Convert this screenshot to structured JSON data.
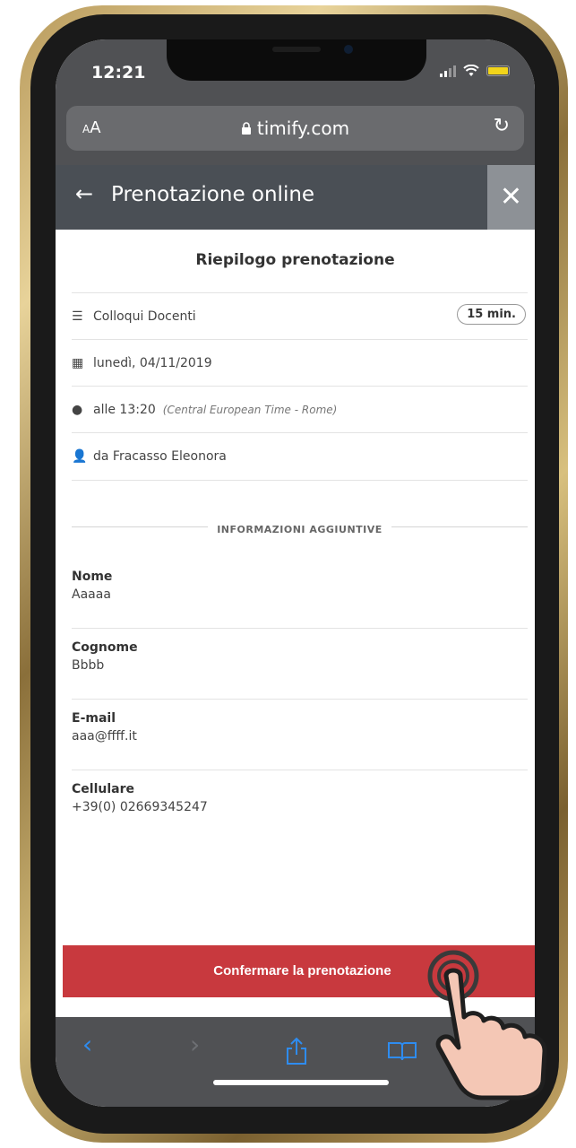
{
  "status_bar": {
    "time": "12:21"
  },
  "safari": {
    "text_size_label": "AA",
    "domain": "timify.com",
    "reload_icon": "reload-icon"
  },
  "header": {
    "back_icon": "arrow-left-icon",
    "title": "Prenotazione online",
    "close_icon": "close-icon"
  },
  "summary": {
    "title": "Riepilogo prenotazione",
    "service": "Colloqui Docenti",
    "duration": "15 min.",
    "date": "lunedì, 04/11/2019",
    "time": "alle 13:20",
    "timezone": "(Central European Time - Rome)",
    "staff": "da Fracasso Eleonora"
  },
  "additional_info": {
    "heading": "INFORMAZIONI AGGIUNTIVE",
    "fields": [
      {
        "label": "Nome",
        "value": "Aaaaa"
      },
      {
        "label": "Cognome",
        "value": "Bbbb"
      },
      {
        "label": "E-mail",
        "value": "aaa@ffff.it"
      },
      {
        "label": "Cellulare",
        "value": "+39(0) 02669345247"
      }
    ]
  },
  "confirm_button": "Confermare la prenotazione",
  "toolbar": {
    "back": "‹",
    "forward": "›",
    "share": "share-icon",
    "bookmarks": "book-icon"
  },
  "colors": {
    "header_bg": "#4a4f55",
    "confirm_bg": "#c8393e",
    "safari_bg": "#505154",
    "accent_blue": "#2e8cf0"
  }
}
